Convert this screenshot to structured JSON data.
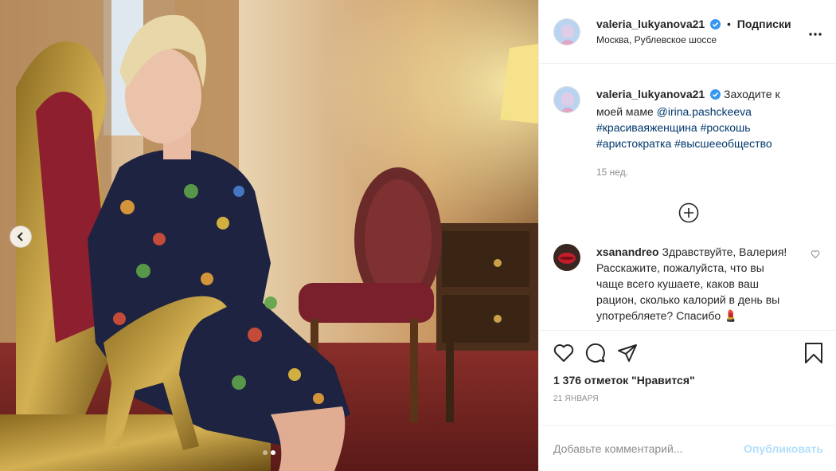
{
  "header": {
    "username": "valeria_lukyanova21",
    "bullet": "•",
    "follow_label": "Подписки",
    "location": "Москва, Рублевское шоссе"
  },
  "caption": {
    "username": "valeria_lukyanova21",
    "text_before": "Заходите к моей маме ",
    "mention": "@irina.pashckeeva",
    "hashtags": [
      "#красиваяженщина",
      "#роскошь",
      "#аристократка",
      "#высшееобщество"
    ],
    "time": "15 нед."
  },
  "comments": [
    {
      "username": "xsanandreo",
      "text": "Здравствуйте, Валерия! Расскажите, пожалуйста, что вы чаще всего кушаете, каков ваш рацион, сколько калорий в день вы употребляете? Спасибо 💄"
    }
  ],
  "likes": "1 376 отметок \"Нравится\"",
  "date": "21 ЯНВАРЯ",
  "add_comment": {
    "placeholder": "Добавьте комментарий...",
    "publish_label": "Опубликовать"
  },
  "carousel": {
    "slides": 2,
    "active_slide": 2
  },
  "icons": {
    "verified": "verified-badge-icon",
    "more": "more-options-icon",
    "load_more": "plus-circle-icon",
    "heart": "heart-icon",
    "comment": "comment-icon",
    "share": "share-icon",
    "save": "bookmark-icon",
    "prev": "chevron-left-icon"
  },
  "colors": {
    "verified": "#3897f0",
    "link": "#00376b",
    "publish_disabled": "#b2dffc",
    "muted": "#8e8e8e"
  }
}
